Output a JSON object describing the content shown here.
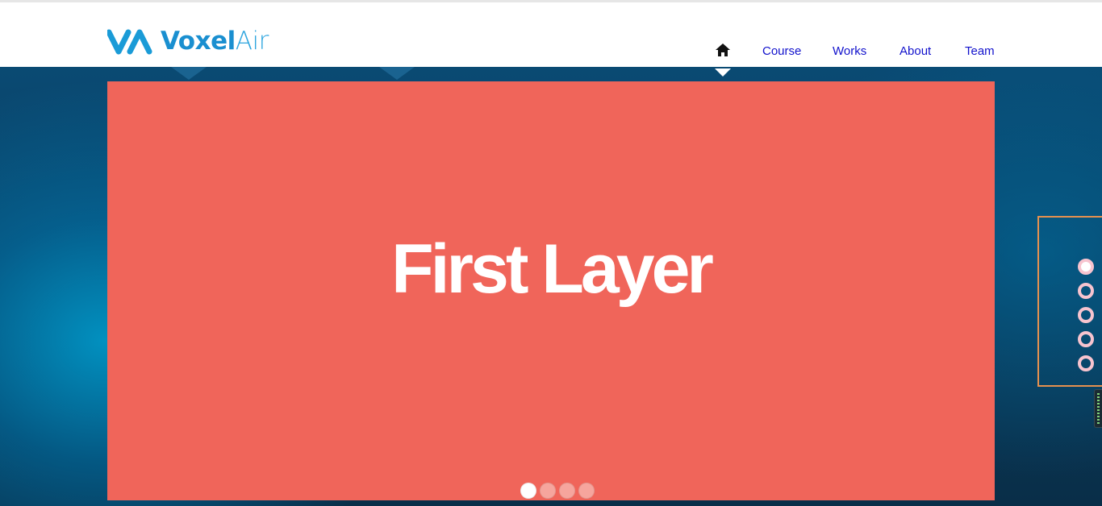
{
  "brand": {
    "logo_icon": "voxelair-logo-mark",
    "name_part1": "Voxel",
    "name_part2": "Air",
    "color": "#1a9bd7"
  },
  "nav": {
    "home_icon": "home-icon",
    "items": [
      {
        "label": "Course"
      },
      {
        "label": "Works"
      },
      {
        "label": "About"
      },
      {
        "label": "Team"
      }
    ],
    "link_color": "#1111cc"
  },
  "slide": {
    "title": "First Layer",
    "background": "#f0655a",
    "dots_count": 4,
    "active_dot": 1
  },
  "side_nav": {
    "dots_count": 5,
    "active_dot": 1,
    "border_color": "#e6914f"
  }
}
